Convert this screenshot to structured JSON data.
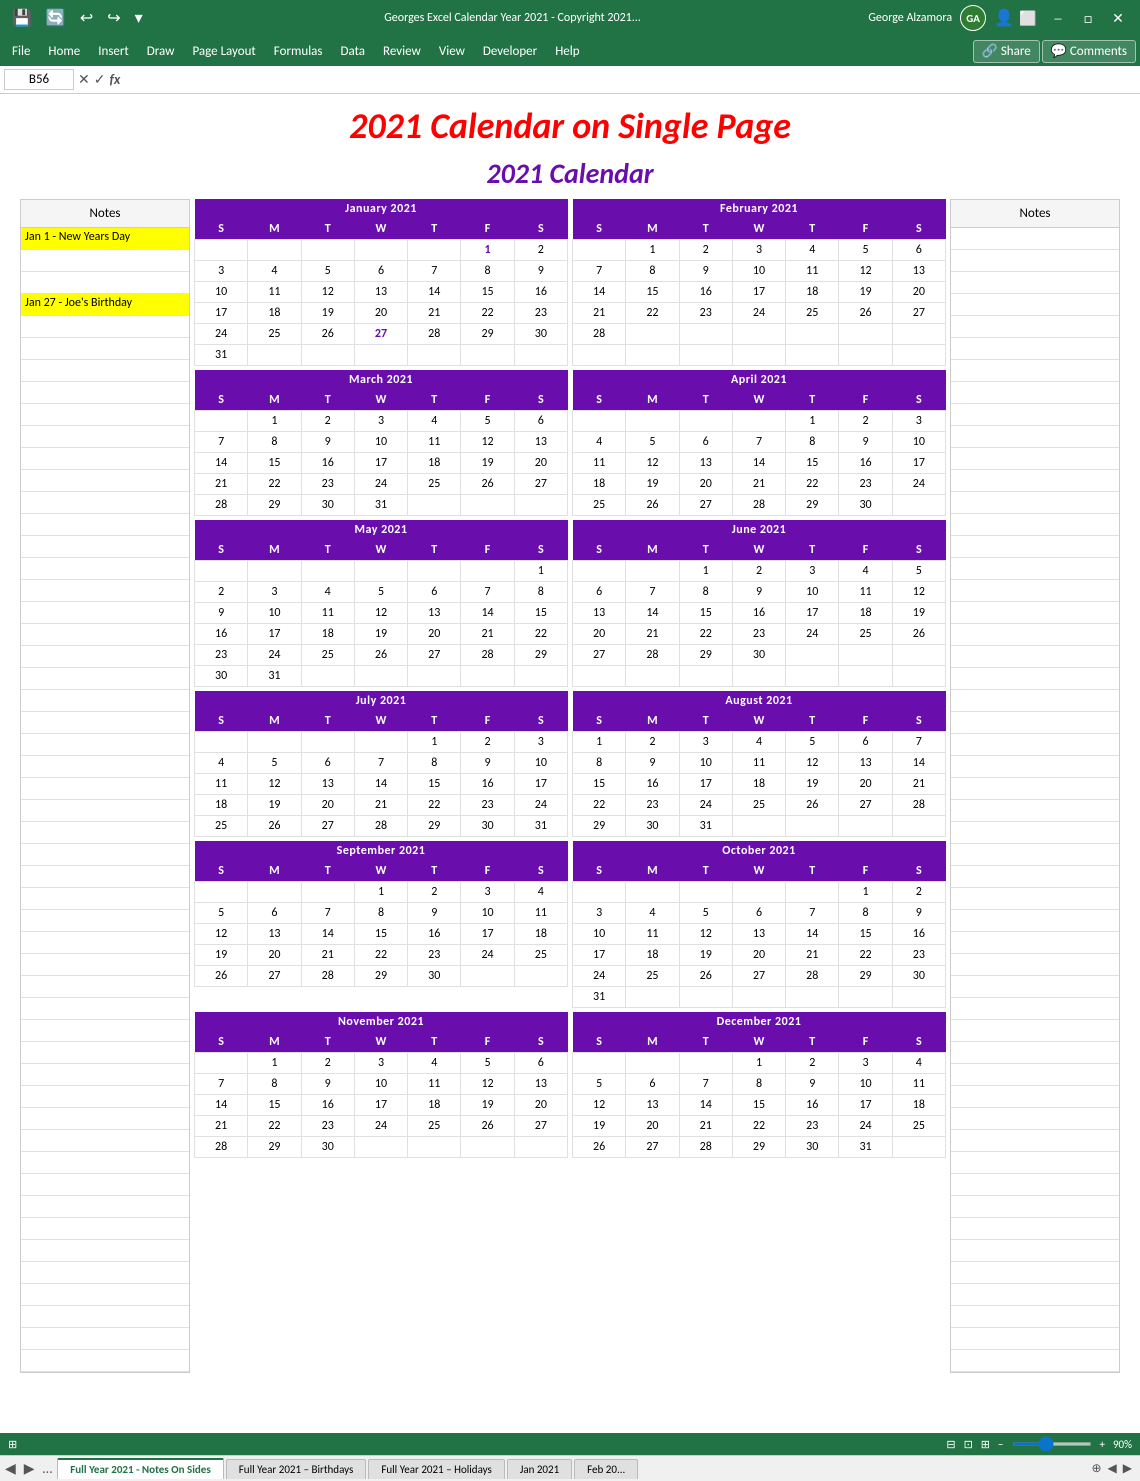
{
  "window": {
    "title": "Georges Excel Calendar Year 2021 - Copyright 2021...",
    "user": "George Alzamora",
    "userInitials": "GA"
  },
  "menubar": {
    "items": [
      "File",
      "Home",
      "Insert",
      "Draw",
      "Page Layout",
      "Formulas",
      "Data",
      "Review",
      "View",
      "Developer",
      "Help"
    ],
    "share": "Share",
    "comments": "Comments"
  },
  "formulaBar": {
    "cellRef": "B56",
    "formula": ""
  },
  "pageTitle": "2021 Calendar on Single Page",
  "calendarTitle": "2021 Calendar",
  "notesHeader": "Notes",
  "notesRightHeader": "Notes",
  "notes": [
    {
      "text": "Jan 1  - New Years Day",
      "style": "yellow"
    },
    {
      "text": "",
      "style": "empty"
    },
    {
      "text": "",
      "style": "empty"
    },
    {
      "text": "Jan 27 - Joe's Birthday",
      "style": "yellow"
    },
    {
      "text": "",
      "style": "empty"
    }
  ],
  "months": [
    {
      "name": "January 2021",
      "days": [
        "S",
        "M",
        "T",
        "W",
        "T",
        "F",
        "S"
      ],
      "weeks": [
        [
          "",
          "",
          "",
          "",
          "",
          "1",
          "2"
        ],
        [
          "3",
          "4",
          "5",
          "6",
          "7",
          "8",
          "9"
        ],
        [
          "10",
          "11",
          "12",
          "13",
          "14",
          "15",
          "16"
        ],
        [
          "17",
          "18",
          "19",
          "20",
          "21",
          "22",
          "23"
        ],
        [
          "24",
          "25",
          "26",
          "27",
          "28",
          "29",
          "30"
        ],
        [
          "31",
          "",
          "",
          "",
          "",
          "",
          ""
        ]
      ],
      "highlights": [
        "1",
        "27"
      ]
    },
    {
      "name": "February 2021",
      "days": [
        "S",
        "M",
        "T",
        "W",
        "T",
        "F",
        "S"
      ],
      "weeks": [
        [
          "",
          "1",
          "2",
          "3",
          "4",
          "5",
          "6"
        ],
        [
          "7",
          "8",
          "9",
          "10",
          "11",
          "12",
          "13"
        ],
        [
          "14",
          "15",
          "16",
          "17",
          "18",
          "19",
          "20"
        ],
        [
          "21",
          "22",
          "23",
          "24",
          "25",
          "26",
          "27"
        ],
        [
          "28",
          "",
          "",
          "",
          "",
          "",
          ""
        ]
      ],
      "highlights": []
    },
    {
      "name": "March 2021",
      "days": [
        "S",
        "M",
        "T",
        "W",
        "T",
        "F",
        "S"
      ],
      "weeks": [
        [
          "",
          "1",
          "2",
          "3",
          "4",
          "5",
          "6"
        ],
        [
          "7",
          "8",
          "9",
          "10",
          "11",
          "12",
          "13"
        ],
        [
          "14",
          "15",
          "16",
          "17",
          "18",
          "19",
          "20"
        ],
        [
          "21",
          "22",
          "23",
          "24",
          "25",
          "26",
          "27"
        ],
        [
          "28",
          "29",
          "30",
          "31",
          "",
          "",
          ""
        ]
      ],
      "highlights": []
    },
    {
      "name": "April 2021",
      "days": [
        "S",
        "M",
        "T",
        "W",
        "T",
        "F",
        "S"
      ],
      "weeks": [
        [
          "",
          "",
          "",
          "",
          "1",
          "2",
          "3"
        ],
        [
          "4",
          "5",
          "6",
          "7",
          "8",
          "9",
          "10"
        ],
        [
          "11",
          "12",
          "13",
          "14",
          "15",
          "16",
          "17"
        ],
        [
          "18",
          "19",
          "20",
          "21",
          "22",
          "23",
          "24"
        ],
        [
          "25",
          "26",
          "27",
          "28",
          "29",
          "30",
          ""
        ]
      ],
      "highlights": []
    },
    {
      "name": "May 2021",
      "days": [
        "S",
        "M",
        "T",
        "W",
        "T",
        "F",
        "S"
      ],
      "weeks": [
        [
          "",
          "",
          "",
          "",
          "",
          "",
          "1"
        ],
        [
          "2",
          "3",
          "4",
          "5",
          "6",
          "7",
          "8"
        ],
        [
          "9",
          "10",
          "11",
          "12",
          "13",
          "14",
          "15"
        ],
        [
          "16",
          "17",
          "18",
          "19",
          "20",
          "21",
          "22"
        ],
        [
          "23",
          "24",
          "25",
          "26",
          "27",
          "28",
          "29"
        ],
        [
          "30",
          "31",
          "",
          "",
          "",
          "",
          ""
        ]
      ],
      "highlights": []
    },
    {
      "name": "June 2021",
      "days": [
        "S",
        "M",
        "T",
        "W",
        "T",
        "F",
        "S"
      ],
      "weeks": [
        [
          "",
          "",
          "1",
          "2",
          "3",
          "4",
          "5"
        ],
        [
          "6",
          "7",
          "8",
          "9",
          "10",
          "11",
          "12"
        ],
        [
          "13",
          "14",
          "15",
          "16",
          "17",
          "18",
          "19"
        ],
        [
          "20",
          "21",
          "22",
          "23",
          "24",
          "25",
          "26"
        ],
        [
          "27",
          "28",
          "29",
          "30",
          "",
          "",
          ""
        ]
      ],
      "highlights": []
    },
    {
      "name": "July 2021",
      "days": [
        "S",
        "M",
        "T",
        "W",
        "T",
        "F",
        "S"
      ],
      "weeks": [
        [
          "",
          "",
          "",
          "",
          "1",
          "2",
          "3"
        ],
        [
          "4",
          "5",
          "6",
          "7",
          "8",
          "9",
          "10"
        ],
        [
          "11",
          "12",
          "13",
          "14",
          "15",
          "16",
          "17"
        ],
        [
          "18",
          "19",
          "20",
          "21",
          "22",
          "23",
          "24"
        ],
        [
          "25",
          "26",
          "27",
          "28",
          "29",
          "30",
          "31"
        ]
      ],
      "highlights": []
    },
    {
      "name": "August 2021",
      "days": [
        "S",
        "M",
        "T",
        "W",
        "T",
        "F",
        "S"
      ],
      "weeks": [
        [
          "1",
          "2",
          "3",
          "4",
          "5",
          "6",
          "7"
        ],
        [
          "8",
          "9",
          "10",
          "11",
          "12",
          "13",
          "14"
        ],
        [
          "15",
          "16",
          "17",
          "18",
          "19",
          "20",
          "21"
        ],
        [
          "22",
          "23",
          "24",
          "25",
          "26",
          "27",
          "28"
        ],
        [
          "29",
          "30",
          "31",
          "",
          "",
          "",
          ""
        ]
      ],
      "highlights": []
    },
    {
      "name": "September 2021",
      "days": [
        "S",
        "M",
        "T",
        "W",
        "T",
        "F",
        "S"
      ],
      "weeks": [
        [
          "",
          "",
          "",
          "1",
          "2",
          "3",
          "4"
        ],
        [
          "5",
          "6",
          "7",
          "8",
          "9",
          "10",
          "11"
        ],
        [
          "12",
          "13",
          "14",
          "15",
          "16",
          "17",
          "18"
        ],
        [
          "19",
          "20",
          "21",
          "22",
          "23",
          "24",
          "25"
        ],
        [
          "26",
          "27",
          "28",
          "29",
          "30",
          "",
          ""
        ]
      ],
      "highlights": []
    },
    {
      "name": "October 2021",
      "days": [
        "S",
        "M",
        "T",
        "W",
        "T",
        "F",
        "S"
      ],
      "weeks": [
        [
          "",
          "",
          "",
          "",
          "",
          "1",
          "2"
        ],
        [
          "3",
          "4",
          "5",
          "6",
          "7",
          "8",
          "9"
        ],
        [
          "10",
          "11",
          "12",
          "13",
          "14",
          "15",
          "16"
        ],
        [
          "17",
          "18",
          "19",
          "20",
          "21",
          "22",
          "23"
        ],
        [
          "24",
          "25",
          "26",
          "27",
          "28",
          "29",
          "30"
        ],
        [
          "31",
          "",
          "",
          "",
          "",
          "",
          ""
        ]
      ],
      "highlights": []
    },
    {
      "name": "November 2021",
      "days": [
        "S",
        "M",
        "T",
        "W",
        "T",
        "F",
        "S"
      ],
      "weeks": [
        [
          "",
          "1",
          "2",
          "3",
          "4",
          "5",
          "6"
        ],
        [
          "7",
          "8",
          "9",
          "10",
          "11",
          "12",
          "13"
        ],
        [
          "14",
          "15",
          "16",
          "17",
          "18",
          "19",
          "20"
        ],
        [
          "21",
          "22",
          "23",
          "24",
          "25",
          "26",
          "27"
        ],
        [
          "28",
          "29",
          "30",
          "",
          "",
          "",
          ""
        ]
      ],
      "highlights": []
    },
    {
      "name": "December 2021",
      "days": [
        "S",
        "M",
        "T",
        "W",
        "T",
        "F",
        "S"
      ],
      "weeks": [
        [
          "",
          "",
          "",
          "1",
          "2",
          "3",
          "4"
        ],
        [
          "5",
          "6",
          "7",
          "8",
          "9",
          "10",
          "11"
        ],
        [
          "12",
          "13",
          "14",
          "15",
          "16",
          "17",
          "18"
        ],
        [
          "19",
          "20",
          "21",
          "22",
          "23",
          "24",
          "25"
        ],
        [
          "26",
          "27",
          "28",
          "29",
          "30",
          "31",
          ""
        ]
      ],
      "highlights": []
    }
  ],
  "tabs": [
    {
      "label": "Full Year 2021 - Notes On Sides",
      "active": true
    },
    {
      "label": "Full Year 2021 – Birthdays",
      "active": false
    },
    {
      "label": "Full Year 2021 – Holidays",
      "active": false
    },
    {
      "label": "Jan 2021",
      "active": false
    },
    {
      "label": "Feb 20...",
      "active": false
    }
  ],
  "statusBar": {
    "zoom": "90%"
  }
}
